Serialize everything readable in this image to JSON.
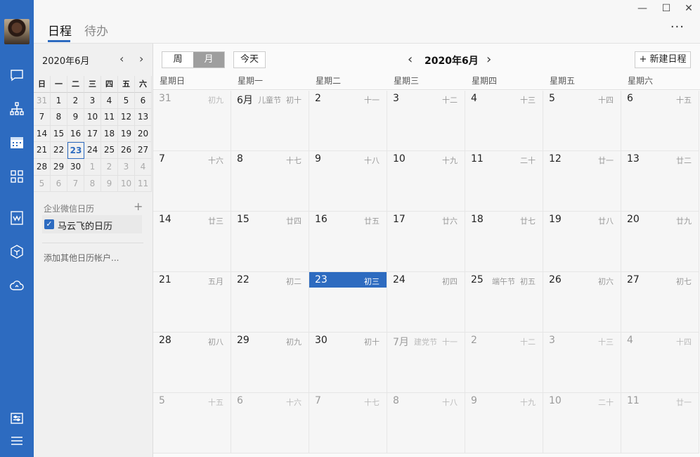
{
  "header": {
    "tabs": [
      {
        "label": "日程",
        "active": true
      },
      {
        "label": "待办",
        "active": false
      }
    ],
    "more_label": "···",
    "window": {
      "minimize": "—",
      "maximize": "☐",
      "close": "✕"
    }
  },
  "rail": {
    "icons": [
      "chat-icon",
      "org-chart-icon",
      "calendar-icon",
      "apps-grid-icon",
      "document-icon",
      "cube-icon",
      "cloud-icon",
      "settings-sliders-icon",
      "menu-icon"
    ],
    "accent": "#2d6bc0"
  },
  "sidebar": {
    "mini_title": "2020年6月",
    "prev": "‹",
    "next": "›",
    "weekdays": [
      "日",
      "一",
      "二",
      "三",
      "四",
      "五",
      "六"
    ],
    "weeks": [
      [
        "31",
        "1",
        "2",
        "3",
        "4",
        "5",
        "6"
      ],
      [
        "7",
        "8",
        "9",
        "10",
        "11",
        "12",
        "13"
      ],
      [
        "14",
        "15",
        "16",
        "17",
        "18",
        "19",
        "20"
      ],
      [
        "21",
        "22",
        "23",
        "24",
        "25",
        "26",
        "27"
      ],
      [
        "28",
        "29",
        "30",
        "1",
        "2",
        "3",
        "4"
      ],
      [
        "5",
        "6",
        "7",
        "8",
        "9",
        "10",
        "11"
      ]
    ],
    "selected": "23",
    "section_title": "企业微信日历",
    "add_icon": "+",
    "calendar_item": "马云飞的日历",
    "add_other": "添加其他日历帐户..."
  },
  "toolbar": {
    "view_week": "周",
    "view_month": "月",
    "today": "今天",
    "prev": "‹",
    "next": "›",
    "title": "2020年6月",
    "new_event": "+ 新建日程"
  },
  "weekday_headers": [
    "星期日",
    "星期一",
    "星期二",
    "星期三",
    "星期四",
    "星期五",
    "星期六"
  ],
  "month_grid": [
    [
      {
        "num": "31",
        "lunar": "初九",
        "other": true
      },
      {
        "num": "6月",
        "fest": "儿童节",
        "lunar": "初十"
      },
      {
        "num": "2",
        "lunar": "十一"
      },
      {
        "num": "3",
        "lunar": "十二"
      },
      {
        "num": "4",
        "lunar": "十三"
      },
      {
        "num": "5",
        "lunar": "十四"
      },
      {
        "num": "6",
        "lunar": "十五"
      }
    ],
    [
      {
        "num": "7",
        "lunar": "十六"
      },
      {
        "num": "8",
        "lunar": "十七"
      },
      {
        "num": "9",
        "lunar": "十八"
      },
      {
        "num": "10",
        "lunar": "十九"
      },
      {
        "num": "11",
        "lunar": "二十"
      },
      {
        "num": "12",
        "lunar": "廿一"
      },
      {
        "num": "13",
        "lunar": "廿二"
      }
    ],
    [
      {
        "num": "14",
        "lunar": "廿三"
      },
      {
        "num": "15",
        "lunar": "廿四"
      },
      {
        "num": "16",
        "lunar": "廿五"
      },
      {
        "num": "17",
        "lunar": "廿六"
      },
      {
        "num": "18",
        "lunar": "廿七"
      },
      {
        "num": "19",
        "lunar": "廿八"
      },
      {
        "num": "20",
        "lunar": "廿九"
      }
    ],
    [
      {
        "num": "21",
        "lunar": "五月"
      },
      {
        "num": "22",
        "lunar": "初二"
      },
      {
        "num": "23",
        "lunar": "初三",
        "today": true
      },
      {
        "num": "24",
        "lunar": "初四"
      },
      {
        "num": "25",
        "fest": "端午节",
        "lunar": "初五"
      },
      {
        "num": "26",
        "lunar": "初六"
      },
      {
        "num": "27",
        "lunar": "初七"
      }
    ],
    [
      {
        "num": "28",
        "lunar": "初八"
      },
      {
        "num": "29",
        "lunar": "初九"
      },
      {
        "num": "30",
        "lunar": "初十"
      },
      {
        "num": "7月",
        "fest": "建党节",
        "lunar": "十一",
        "other": true
      },
      {
        "num": "2",
        "lunar": "十二",
        "other": true
      },
      {
        "num": "3",
        "lunar": "十三",
        "other": true
      },
      {
        "num": "4",
        "lunar": "十四",
        "other": true
      }
    ],
    [
      {
        "num": "5",
        "lunar": "十五",
        "other": true
      },
      {
        "num": "6",
        "lunar": "十六",
        "other": true
      },
      {
        "num": "7",
        "lunar": "十七",
        "other": true
      },
      {
        "num": "8",
        "lunar": "十八",
        "other": true
      },
      {
        "num": "9",
        "lunar": "十九",
        "other": true
      },
      {
        "num": "10",
        "lunar": "二十",
        "other": true
      },
      {
        "num": "11",
        "lunar": "廿一",
        "other": true
      }
    ]
  ]
}
